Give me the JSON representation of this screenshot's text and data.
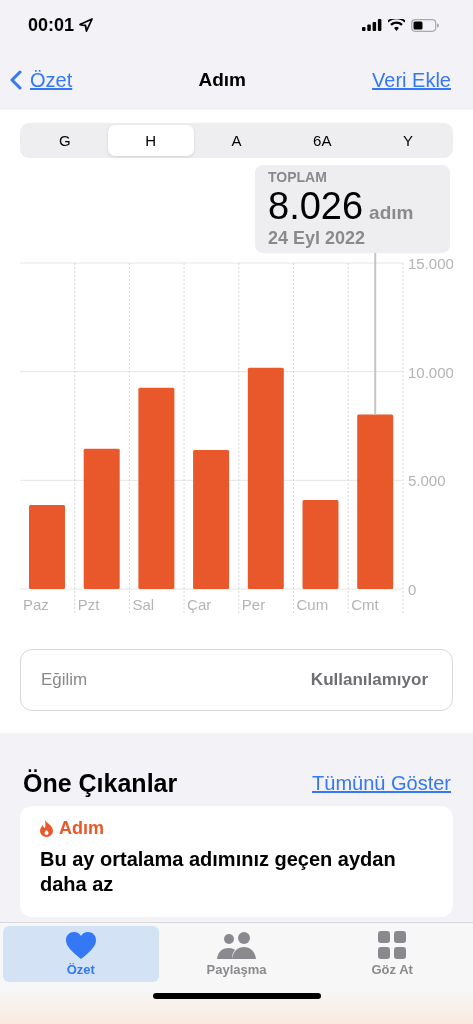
{
  "status_bar": {
    "time": "00:01"
  },
  "nav": {
    "back": "Özet",
    "title": "Adım",
    "action": "Veri Ekle"
  },
  "segments": [
    {
      "label": "G",
      "selected": false
    },
    {
      "label": "H",
      "selected": true
    },
    {
      "label": "A",
      "selected": false
    },
    {
      "label": "6A",
      "selected": false
    },
    {
      "label": "Y",
      "selected": false
    }
  ],
  "summary": {
    "label": "TOPLAM",
    "value": "8.026",
    "unit": "adım",
    "date": "24 Eyl 2022"
  },
  "chart_data": {
    "type": "bar",
    "categories": [
      "Paz",
      "Pzt",
      "Sal",
      "Çar",
      "Per",
      "Cum",
      "Cmt"
    ],
    "series": [
      {
        "color": "#e8582a",
        "values": [
          3870,
          6450,
          9260,
          6400,
          10180,
          4100,
          8026
        ]
      }
    ],
    "ylim": [
      0,
      15000
    ],
    "yticks": [
      {
        "value": 0,
        "label": "0"
      },
      {
        "value": 5000,
        "label": "5.000"
      },
      {
        "value": 10000,
        "label": "10.000"
      },
      {
        "value": 15000,
        "label": "15.000"
      }
    ],
    "annotations": [
      {
        "x": "Cmt"
      }
    ]
  },
  "trend": {
    "label": "Eğilim",
    "value": "Kullanılamıyor"
  },
  "highlights": {
    "title": "Öne Çıkanlar",
    "link": "Tümünü Göster",
    "card": {
      "category": "Adım",
      "text": "Bu ay ortalama adımınız geçen aydan daha az"
    }
  },
  "tab_bar": [
    {
      "label": "Özet",
      "kind": "heart",
      "selected": true
    },
    {
      "label": "Paylaşma",
      "kind": "people",
      "selected": false
    },
    {
      "label": "Göz At",
      "kind": "grid",
      "selected": false
    }
  ]
}
